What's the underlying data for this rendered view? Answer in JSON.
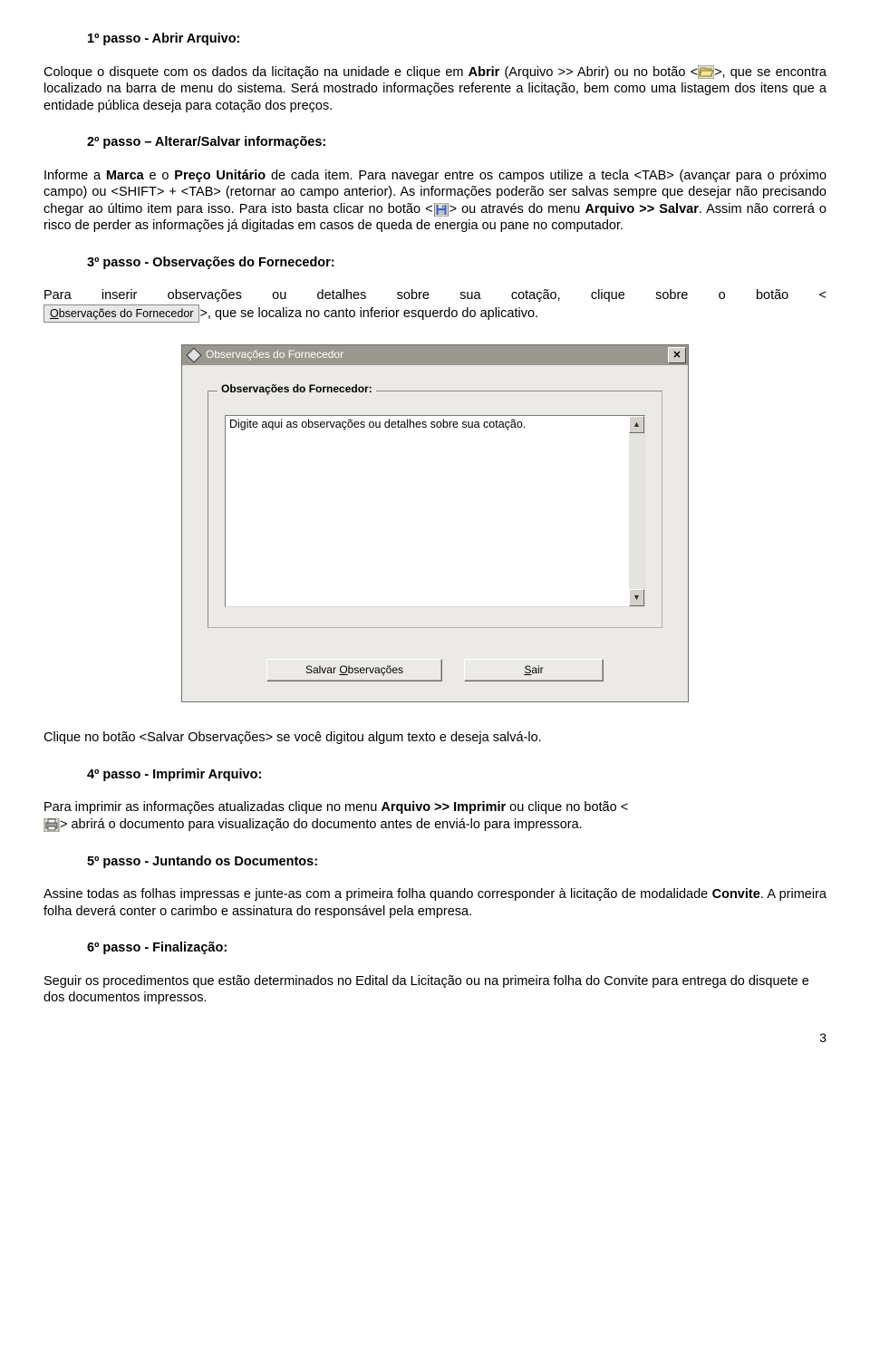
{
  "step1": {
    "title": "1º passo - Abrir Arquivo:",
    "p1a": "Coloque o disquete com os dados da licitação na unidade e clique em ",
    "p1b_bold": "Abrir",
    "p1c": " (Arquivo >> Abrir) ou no botão <",
    "p1d": ">, que se encontra localizado na barra de menu do sistema. Será mostrado informações referente a licitação, bem como uma listagem dos itens que a entidade pública deseja para cotação dos preços."
  },
  "step2": {
    "title": "2º passo – Alterar/Salvar informações:",
    "p1a": "Informe a ",
    "p1b_bold": "Marca",
    "p1c": " e o ",
    "p1d_bold": "Preço Unitário",
    "p1e": " de cada item. Para navegar entre os campos utilize a tecla <TAB> (avançar para o próximo campo) ou <SHIFT> + <TAB> (retornar ao campo anterior). As informações poderão ser salvas sempre que desejar não precisando chegar ao último item para isso. Para isto basta clicar no botão <",
    "p1f": "> ou através do menu ",
    "p1g_bold": "Arquivo >> Salvar",
    "p1h": ". Assim não correrá o risco de perder as informações já digitadas em casos de queda de energia ou pane no computador."
  },
  "step3": {
    "title": "3º passo - Observações do Fornecedor:",
    "line1": "Para   inserir   observações   ou   detalhes   sobre   sua   cotação,   clique   sobre   o   botão   <",
    "btn_ul": "O",
    "btn_rest": "bservações do Fornecedor",
    "line2_rest": ">, que se localiza no canto inferior esquerdo do aplicativo."
  },
  "dialog": {
    "title": "Observações do Fornecedor",
    "group_label": "Observações do Fornecedor:",
    "textarea_text": "Digite aqui as observações ou detalhes sobre sua cotação.",
    "btn_save_ul": "O",
    "btn_save_rest": "bservações",
    "btn_save_prefix": "Salvar ",
    "btn_exit_ul": "S",
    "btn_exit_rest": "air"
  },
  "after_dialog": "Clique no botão <Salvar Observações> se você digitou algum texto e deseja salvá-lo.",
  "step4": {
    "title": "4º passo - Imprimir Arquivo:",
    "p1a": "Para imprimir as informações atualizadas clique no menu ",
    "p1b_bold": "Arquivo >> Imprimir",
    "p1c": " ou clique no botão <",
    "p1d": "> abrirá o documento para visualização do documento antes de enviá-lo para impressora."
  },
  "step5": {
    "title": "5º passo - Juntando os Documentos:",
    "p1a": "Assine todas as folhas impressas e junte-as com a primeira folha quando corresponder à licitação de modalidade ",
    "p1b_bold": "Convite",
    "p1c": ". A primeira folha deverá conter o carimbo e assinatura do responsável pela empresa."
  },
  "step6": {
    "title": "6º passo - Finalização:",
    "p1": "Seguir os procedimentos que estão determinados no Edital da Licitação ou na primeira folha do Convite para entrega do disquete e dos documentos impressos."
  },
  "page_number": "3"
}
